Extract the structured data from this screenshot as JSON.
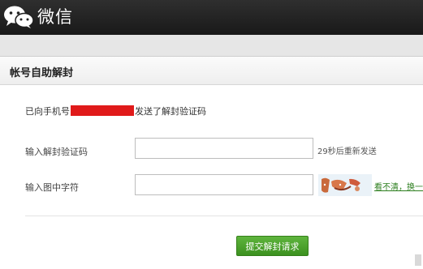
{
  "header": {
    "app_title": "微信",
    "logo_icon": "wechat-logo-icon"
  },
  "card": {
    "title": "帐号自助解封",
    "notice_prefix": "已向手机号",
    "notice_suffix": "发送了解封验证码",
    "code_label": "输入解封验证码",
    "code_value": "",
    "resend_text": "29秒后重新发送",
    "captcha_label": "输入图中字符",
    "captcha_value": "",
    "refresh_link": "看不清，换一",
    "submit_label": "提交解封请求"
  },
  "colors": {
    "topbar": "#1f1f1f",
    "redaction": "#e01a1a",
    "submit_button": "#4aa12a",
    "link": "#2d7f1f"
  }
}
